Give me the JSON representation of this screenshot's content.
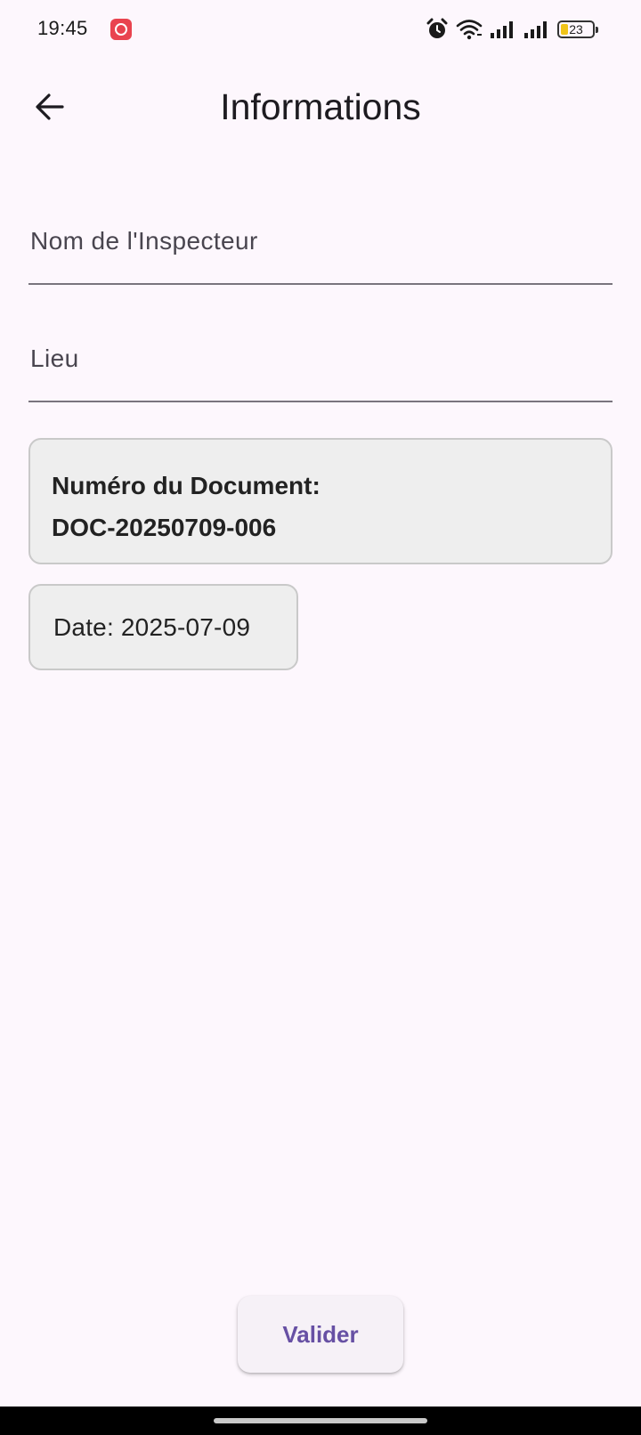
{
  "status_bar": {
    "time": "19:45",
    "battery_level": "23",
    "icons": [
      "app-notification-icon",
      "alarm-icon",
      "wifi-icon",
      "signal-icon",
      "signal-icon",
      "battery-icon"
    ]
  },
  "app_bar": {
    "title": "Informations",
    "back_icon": "arrow-back-icon"
  },
  "form": {
    "inspector_field": {
      "placeholder": "Nom de l'Inspecteur",
      "value": ""
    },
    "location_field": {
      "placeholder": "Lieu",
      "value": ""
    }
  },
  "document_card": {
    "label": "Numéro du Document:",
    "number": "DOC-20250709-006"
  },
  "date_card": {
    "text": "Date: 2025-07-09"
  },
  "actions": {
    "submit_label": "Valider"
  },
  "colors": {
    "background": "#fdf7fd",
    "accent": "#6750a4",
    "card_background": "#eeeeee",
    "notification_badge": "#e9434f"
  }
}
